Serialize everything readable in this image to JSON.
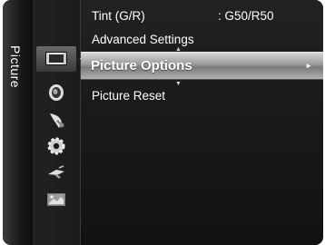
{
  "sidebar": {
    "label": "Picture"
  },
  "icons": [
    {
      "name": "picture-icon",
      "selected": true
    },
    {
      "name": "sound-icon",
      "selected": false
    },
    {
      "name": "satellite-dish-icon",
      "selected": false
    },
    {
      "name": "setup-gear-icon",
      "selected": false
    },
    {
      "name": "input-plug-icon",
      "selected": false
    },
    {
      "name": "application-icon",
      "selected": false
    }
  ],
  "menu": {
    "items": [
      {
        "label": "Tint (G/R)",
        "value": ": G50/R50"
      },
      {
        "label": "Advanced Settings"
      },
      {
        "label": "Picture Options",
        "selected": true,
        "arrow": "►"
      },
      {
        "label": "Picture Reset"
      }
    ],
    "scroll_up_glyph": "▲",
    "scroll_down_glyph": "▼"
  },
  "colors": {
    "background": "#121212",
    "highlight": "#a8a8a8",
    "text": "#ffffff"
  }
}
